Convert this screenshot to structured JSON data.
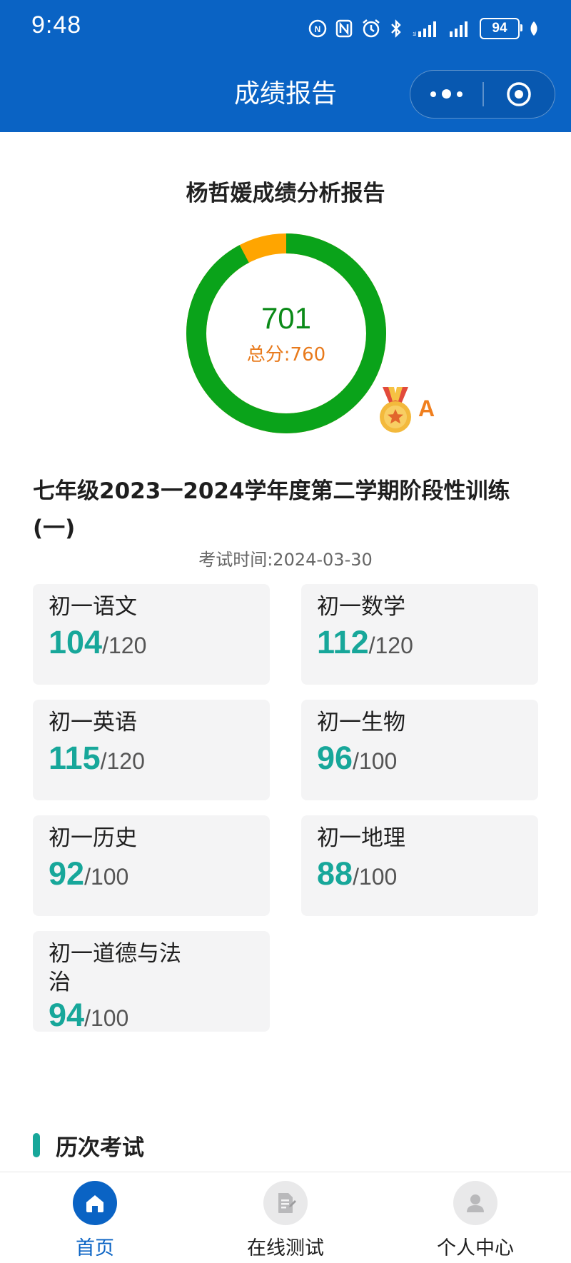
{
  "status_bar": {
    "time": "9:48",
    "battery": "94",
    "icons": [
      "nfc-icon",
      "alarm-icon",
      "bluetooth-icon",
      "signal-icon",
      "signal-icon",
      "battery-icon",
      "leaf-icon"
    ]
  },
  "nav": {
    "title": "成绩报告",
    "more_icon": "more-dots-icon",
    "close_icon": "target-circle-icon"
  },
  "report": {
    "title": "杨哲媛成绩分析报告",
    "score": "701",
    "total_label": "总分:760",
    "score_value": 701,
    "total_value": 760,
    "grade": "A",
    "colors": {
      "gained": "#0aa31a",
      "lost": "#ffa500"
    }
  },
  "exam": {
    "name": "七年级2023一2024学年度第二学期阶段性训练(一)",
    "date_label": "考试时间:",
    "date": "2024-03-30"
  },
  "subjects": [
    {
      "name": "初一语文",
      "score": "104",
      "full": "120"
    },
    {
      "name": "初一数学",
      "score": "112",
      "full": "120"
    },
    {
      "name": "初一英语",
      "score": "115",
      "full": "120"
    },
    {
      "name": "初一生物",
      "score": "96",
      "full": "100"
    },
    {
      "name": "初一历史",
      "score": "92",
      "full": "100"
    },
    {
      "name": "初一地理",
      "score": "88",
      "full": "100"
    },
    {
      "name": "初一道德与法治",
      "score": "94",
      "full": "100"
    }
  ],
  "history": {
    "title": "历次考试"
  },
  "tabbar": {
    "items": [
      {
        "label": "首页",
        "icon": "home-icon",
        "active": true
      },
      {
        "label": "在线测试",
        "icon": "test-paper-icon",
        "active": false
      },
      {
        "label": "个人中心",
        "icon": "user-icon",
        "active": false
      }
    ],
    "active_color": "#0a63c4"
  }
}
